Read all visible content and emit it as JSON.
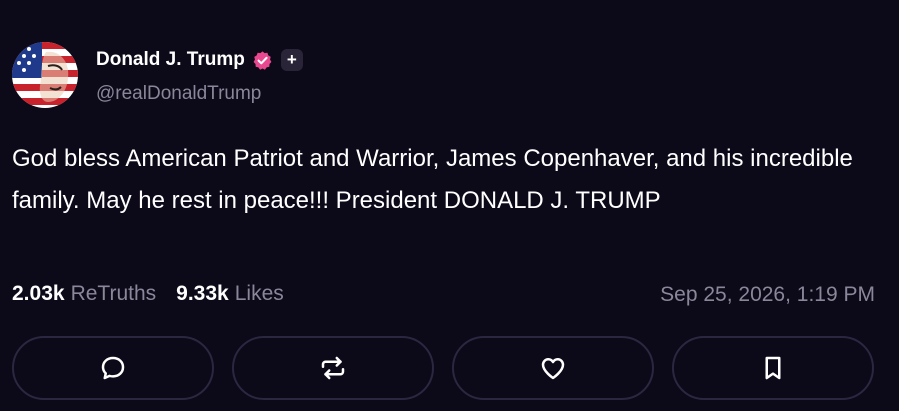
{
  "author": {
    "display_name": "Donald J. Trump",
    "handle": "@realDonaldTrump",
    "verified_color": "#e8488f",
    "plus_badge": "+"
  },
  "post": {
    "text": "God bless American Patriot and Warrior, James Copenhaver, and his incredible family. May he rest in peace!!! President DONALD J. TRUMP",
    "retruths_count": "2.03k",
    "retruths_label": "ReTruths",
    "likes_count": "9.33k",
    "likes_label": "Likes",
    "timestamp": "Sep 25, 2026, 1:19 PM"
  },
  "actions": [
    {
      "name": "reply",
      "icon": "chat-bubble-icon"
    },
    {
      "name": "retruth",
      "icon": "repost-icon"
    },
    {
      "name": "like",
      "icon": "heart-icon"
    },
    {
      "name": "bookmark",
      "icon": "bookmark-icon"
    }
  ],
  "colors": {
    "background": "#0c0919",
    "muted_text": "#8b879a",
    "border": "#2c2740"
  }
}
